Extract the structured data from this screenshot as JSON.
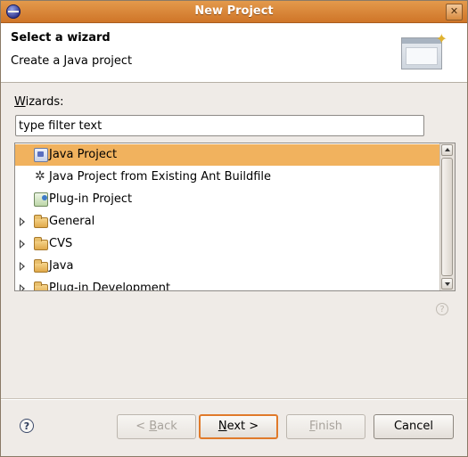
{
  "window": {
    "title": "New Project"
  },
  "header": {
    "title": "Select a wizard",
    "description": "Create a Java project"
  },
  "wizards": {
    "label_first": "W",
    "label_rest": "izards:",
    "filter_value": "type filter text"
  },
  "tree": {
    "items": [
      {
        "label": "Java Project",
        "icon": "java-project-icon",
        "selected": true,
        "expandable": false
      },
      {
        "label": "Java Project from Existing Ant Buildfile",
        "icon": "ant-icon",
        "selected": false,
        "expandable": false
      },
      {
        "label": "Plug-in Project",
        "icon": "plugin-project-icon",
        "selected": false,
        "expandable": false
      },
      {
        "label": "General",
        "icon": "folder-icon",
        "selected": false,
        "expandable": true
      },
      {
        "label": "CVS",
        "icon": "folder-icon",
        "selected": false,
        "expandable": true
      },
      {
        "label": "Java",
        "icon": "folder-icon",
        "selected": false,
        "expandable": true
      },
      {
        "label": "Plug-in Development",
        "icon": "folder-icon",
        "selected": false,
        "expandable": true
      }
    ]
  },
  "buttons": {
    "back_prefix": "< ",
    "back_mnemonic": "B",
    "back_rest": "ack",
    "next_mnemonic": "N",
    "next_rest": "ext >",
    "finish_mnemonic": "F",
    "finish_rest": "inish",
    "cancel": "Cancel"
  },
  "help": {
    "symbol": "?"
  },
  "colors": {
    "titlebar": "#dd8a3e",
    "selection": "#f1b25e",
    "default_button_border": "#e07a2a"
  }
}
